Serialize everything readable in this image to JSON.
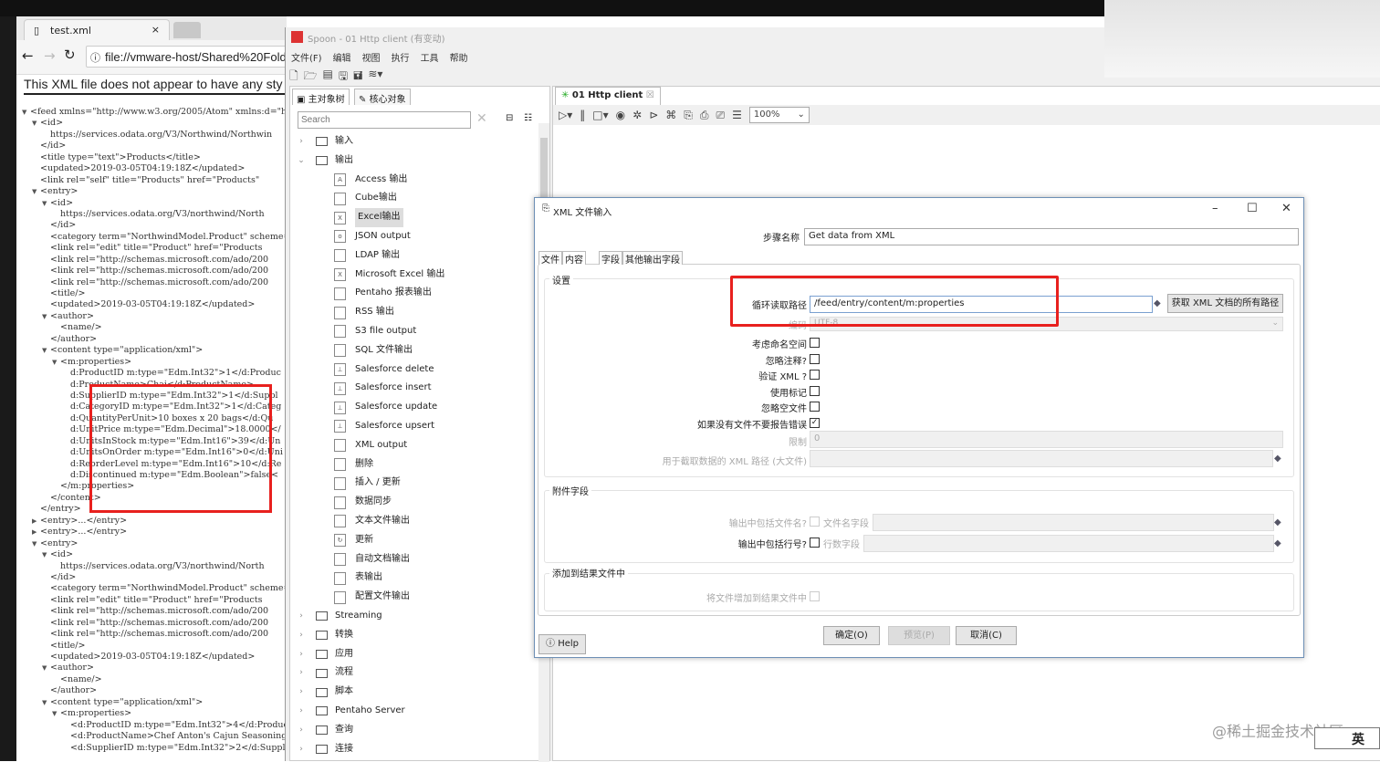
{
  "browser": {
    "tab_title": "test.xml",
    "tab_close": "×",
    "url": "file://vmware-host/Shared%20Fold",
    "xml_notice": "This XML file does not appear to have any sty",
    "xml_lines": [
      {
        "d": 0,
        "a": "v",
        "t": "<feed xmlns=\"http://www.w3.org/2005/Atom\" xmlns:d=\"h"
      },
      {
        "d": 1,
        "a": "v",
        "t": "<id>"
      },
      {
        "d": 2,
        "a": "",
        "t": "https://services.odata.org/V3/Northwind/Northwin"
      },
      {
        "d": 1,
        "a": "",
        "t": "</id>"
      },
      {
        "d": 1,
        "a": "",
        "t": "<title type=\"text\">Products</title>"
      },
      {
        "d": 1,
        "a": "",
        "t": "<updated>2019-03-05T04:19:18Z</updated>"
      },
      {
        "d": 1,
        "a": "",
        "t": "<link rel=\"self\" title=\"Products\" href=\"Products\""
      },
      {
        "d": 1,
        "a": "v",
        "t": "<entry>"
      },
      {
        "d": 2,
        "a": "v",
        "t": "<id>"
      },
      {
        "d": 3,
        "a": "",
        "t": "https://services.odata.org/V3/northwind/North"
      },
      {
        "d": 2,
        "a": "",
        "t": "</id>"
      },
      {
        "d": 2,
        "a": "",
        "t": "<category term=\"NorthwindModel.Product\" scheme="
      },
      {
        "d": 2,
        "a": "",
        "t": "<link rel=\"edit\" title=\"Product\" href=\"Products"
      },
      {
        "d": 2,
        "a": "",
        "t": "<link rel=\"http://schemas.microsoft.com/ado/200"
      },
      {
        "d": 2,
        "a": "",
        "t": "<link rel=\"http://schemas.microsoft.com/ado/200"
      },
      {
        "d": 2,
        "a": "",
        "t": "<link rel=\"http://schemas.microsoft.com/ado/200"
      },
      {
        "d": 2,
        "a": "",
        "t": "<title/>"
      },
      {
        "d": 2,
        "a": "",
        "t": "<updated>2019-03-05T04:19:18Z</updated>"
      },
      {
        "d": 2,
        "a": "v",
        "t": "<author>"
      },
      {
        "d": 3,
        "a": "",
        "t": "<name/>"
      },
      {
        "d": 2,
        "a": "",
        "t": "</author>"
      },
      {
        "d": 2,
        "a": "v",
        "t": "<content type=\"application/xml\">"
      },
      {
        "d": 3,
        "a": "v",
        "t": "<m:properties>"
      },
      {
        "d": 4,
        "a": "",
        "t": "d:ProductID m:type=\"Edm.Int32\">1</d:Produc"
      },
      {
        "d": 4,
        "a": "",
        "t": "d:ProductName>Chai</d:ProductName>"
      },
      {
        "d": 4,
        "a": "",
        "t": "d:SupplierID m:type=\"Edm.Int32\">1</d:Suppl"
      },
      {
        "d": 4,
        "a": "",
        "t": "d:CategoryID m:type=\"Edm.Int32\">1</d:Categ"
      },
      {
        "d": 4,
        "a": "",
        "t": "d:QuantityPerUnit>10 boxes x 20 bags</d:Qu"
      },
      {
        "d": 4,
        "a": "",
        "t": "d:UnitPrice m:type=\"Edm.Decimal\">18.0000</"
      },
      {
        "d": 4,
        "a": "",
        "t": "d:UnitsInStock m:type=\"Edm.Int16\">39</d:Un"
      },
      {
        "d": 4,
        "a": "",
        "t": "d:UnitsOnOrder m:type=\"Edm.Int16\">0</d:Uni"
      },
      {
        "d": 4,
        "a": "",
        "t": "d:ReorderLevel m:type=\"Edm.Int16\">10</d:Re"
      },
      {
        "d": 4,
        "a": "",
        "t": "d:Discontinued m:type=\"Edm.Boolean\">false<"
      },
      {
        "d": 3,
        "a": "",
        "t": "</m:properties>"
      },
      {
        "d": 2,
        "a": "",
        "t": "</content>"
      },
      {
        "d": 1,
        "a": "",
        "t": "</entry>"
      },
      {
        "d": 1,
        "a": ">",
        "t": "<entry>...</entry>"
      },
      {
        "d": 1,
        "a": ">",
        "t": "<entry>...</entry>"
      },
      {
        "d": 1,
        "a": "v",
        "t": "<entry>"
      },
      {
        "d": 2,
        "a": "v",
        "t": "<id>"
      },
      {
        "d": 3,
        "a": "",
        "t": "https://services.odata.org/V3/northwind/North"
      },
      {
        "d": 2,
        "a": "",
        "t": "</id>"
      },
      {
        "d": 2,
        "a": "",
        "t": "<category term=\"NorthwindModel.Product\" scheme="
      },
      {
        "d": 2,
        "a": "",
        "t": "<link rel=\"edit\" title=\"Product\" href=\"Products"
      },
      {
        "d": 2,
        "a": "",
        "t": "<link rel=\"http://schemas.microsoft.com/ado/200"
      },
      {
        "d": 2,
        "a": "",
        "t": "<link rel=\"http://schemas.microsoft.com/ado/200"
      },
      {
        "d": 2,
        "a": "",
        "t": "<link rel=\"http://schemas.microsoft.com/ado/200"
      },
      {
        "d": 2,
        "a": "",
        "t": "<title/>"
      },
      {
        "d": 2,
        "a": "",
        "t": "<updated>2019-03-05T04:19:18Z</updated>"
      },
      {
        "d": 2,
        "a": "v",
        "t": "<author>"
      },
      {
        "d": 3,
        "a": "",
        "t": "<name/>"
      },
      {
        "d": 2,
        "a": "",
        "t": "</author>"
      },
      {
        "d": 2,
        "a": "v",
        "t": "<content type=\"application/xml\">"
      },
      {
        "d": 3,
        "a": "v",
        "t": "<m:properties>"
      },
      {
        "d": 4,
        "a": "",
        "t": "<d:ProductID m:type=\"Edm.Int32\">4</d:Produc"
      },
      {
        "d": 4,
        "a": "",
        "t": "<d:ProductName>Chef Anton's Cajun Seasoning"
      },
      {
        "d": 4,
        "a": "",
        "t": "<d:SupplierID m:type=\"Edm.Int32\">2</d:Suppl"
      }
    ]
  },
  "spoon": {
    "title": "Spoon - 01 Http client (有变动)",
    "menu": [
      "文件(F)",
      "编辑",
      "视图",
      "执行",
      "工具",
      "帮助"
    ],
    "left_tabs": [
      "主对象树",
      "核心对象"
    ],
    "search_placeholder": "Search",
    "tree": [
      {
        "type": "folder",
        "open": false,
        "label": "输入"
      },
      {
        "type": "folder",
        "open": true,
        "label": "输出"
      },
      {
        "type": "step",
        "label": "Access 输出",
        "icon": "A"
      },
      {
        "type": "step",
        "label": "Cube输出",
        "icon": ""
      },
      {
        "type": "step",
        "label": "Excel输出",
        "icon": "X",
        "selected": true
      },
      {
        "type": "step",
        "label": "JSON output",
        "icon": "o"
      },
      {
        "type": "step",
        "label": "LDAP 输出",
        "icon": ""
      },
      {
        "type": "step",
        "label": "Microsoft Excel 输出",
        "icon": "X"
      },
      {
        "type": "step",
        "label": "Pentaho 报表输出",
        "icon": ""
      },
      {
        "type": "step",
        "label": "RSS 输出",
        "icon": ""
      },
      {
        "type": "step",
        "label": "S3 file output",
        "icon": ""
      },
      {
        "type": "step",
        "label": "SQL 文件输出",
        "icon": ""
      },
      {
        "type": "step",
        "label": "Salesforce delete",
        "icon": "⊥"
      },
      {
        "type": "step",
        "label": "Salesforce insert",
        "icon": "⊥"
      },
      {
        "type": "step",
        "label": "Salesforce update",
        "icon": "⊥"
      },
      {
        "type": "step",
        "label": "Salesforce upsert",
        "icon": "⊥"
      },
      {
        "type": "step",
        "label": "XML output",
        "icon": ""
      },
      {
        "type": "step",
        "label": "删除",
        "icon": ""
      },
      {
        "type": "step",
        "label": "插入 / 更新",
        "icon": ""
      },
      {
        "type": "step",
        "label": "数据同步",
        "icon": ""
      },
      {
        "type": "step",
        "label": "文本文件输出",
        "icon": ""
      },
      {
        "type": "step",
        "label": "更新",
        "icon": "↻"
      },
      {
        "type": "step",
        "label": "自动文档输出",
        "icon": ""
      },
      {
        "type": "step",
        "label": "表输出",
        "icon": ""
      },
      {
        "type": "step",
        "label": "配置文件输出",
        "icon": ""
      },
      {
        "type": "folder",
        "open": false,
        "label": "Streaming"
      },
      {
        "type": "folder",
        "open": false,
        "label": "转换"
      },
      {
        "type": "folder",
        "open": false,
        "label": "应用"
      },
      {
        "type": "folder",
        "open": false,
        "label": "流程"
      },
      {
        "type": "folder",
        "open": false,
        "label": "脚本"
      },
      {
        "type": "folder",
        "open": false,
        "label": "Pentaho Server"
      },
      {
        "type": "folder",
        "open": false,
        "label": "查询"
      },
      {
        "type": "folder",
        "open": false,
        "label": "连接"
      }
    ],
    "canvas_tab": "01 Http client",
    "zoom": "100%"
  },
  "dialog": {
    "title": "XML 文件输入",
    "step_name_label": "步骤名称",
    "step_name": "Get data from XML",
    "tabs": [
      "文件",
      "内容",
      "字段",
      "其他输出字段"
    ],
    "settings_group": "设置",
    "loop_path_label": "循环读取路径",
    "loop_path": "/feed/entry/content/m:properties",
    "get_paths_button": "获取 XML 文档的所有路径",
    "encoding_label": "编码",
    "encoding": "UTF-8",
    "checkboxes": [
      {
        "label": "考虑命名空间",
        "checked": false
      },
      {
        "label": "忽略注释?",
        "checked": false
      },
      {
        "label": "验证 XML ?",
        "checked": false
      },
      {
        "label": "使用标记",
        "checked": false
      },
      {
        "label": "忽略空文件",
        "checked": false
      },
      {
        "label": "如果没有文件不要报告错误",
        "checked": true
      }
    ],
    "limit_label": "限制",
    "limit": "0",
    "prune_label": "用于截取数据的 XML 路径 (大文件)",
    "additional_group": "附件字段",
    "include_filename_label": "输出中包括文件名?",
    "filename_field_label": "文件名字段",
    "include_rownum_label": "输出中包括行号?",
    "rownum_field_label": "行数字段",
    "result_group": "添加到结果文件中",
    "add_to_result_label": "将文件增加到结果文件中",
    "ok": "确定(O)",
    "preview": "预览(P)",
    "cancel": "取消(C)",
    "help": "Help"
  },
  "watermark": "@稀土掘金技术社区",
  "ime": "英"
}
